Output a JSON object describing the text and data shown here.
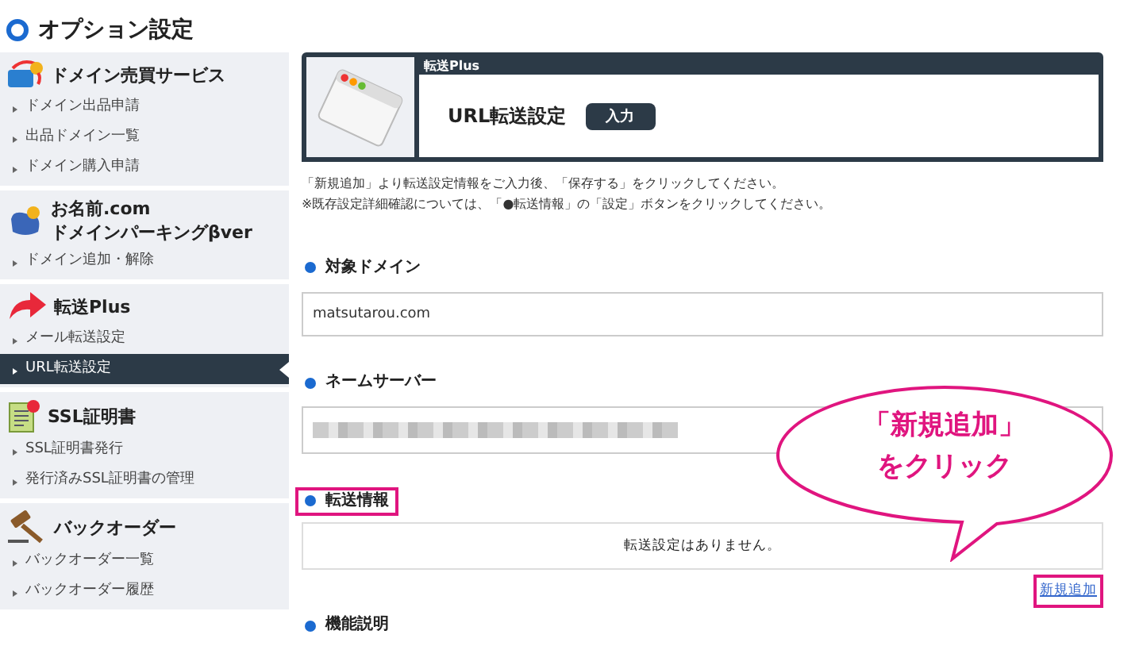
{
  "page_title": "オプション設定",
  "sidebar": [
    {
      "title_lines": [
        "ドメイン売買サービス"
      ],
      "items": [
        {
          "label": "ドメイン出品申請",
          "selected": false
        },
        {
          "label": "出品ドメイン一覧",
          "selected": false
        },
        {
          "label": "ドメイン購入申請",
          "selected": false
        }
      ]
    },
    {
      "title_lines": [
        "お名前.com",
        "ドメインパーキングβver"
      ],
      "items": [
        {
          "label": "ドメイン追加・解除",
          "selected": false
        }
      ]
    },
    {
      "title_lines": [
        "転送Plus"
      ],
      "items": [
        {
          "label": "メール転送設定",
          "selected": false
        },
        {
          "label": "URL転送設定",
          "selected": true
        }
      ]
    },
    {
      "title_lines": [
        "SSL証明書"
      ],
      "items": [
        {
          "label": "SSL証明書発行",
          "selected": false
        },
        {
          "label": "発行済みSSL証明書の管理",
          "selected": false
        }
      ]
    },
    {
      "title_lines": [
        "バックオーダー"
      ],
      "items": [
        {
          "label": "バックオーダー一覧",
          "selected": false
        },
        {
          "label": "バックオーダー履歴",
          "selected": false
        }
      ]
    }
  ],
  "header_card": {
    "category": "転送Plus",
    "title": "URL転送設定",
    "step": "入力"
  },
  "instructions": [
    "「新規追加」より転送設定情報をご入力後、「保存する」をクリックしてください。",
    "※既存設定詳細確認については、「●転送情報」の「設定」ボタンをクリックしてください。"
  ],
  "sections": [
    {
      "kind": "field",
      "heading": "対象ドメイン",
      "value": "matsutarou.com",
      "highlighted": false
    },
    {
      "kind": "blurred",
      "heading": "ネームサーバー",
      "highlighted": false
    },
    {
      "kind": "message",
      "heading": "転送情報",
      "message": "転送設定はありません。",
      "link": "新規追加",
      "highlighted": true,
      "link_highlighted": true
    },
    {
      "kind": "heading",
      "heading": "機能説明",
      "highlighted": false
    }
  ],
  "callout": {
    "lines": [
      "「新規追加」",
      "をクリック"
    ]
  }
}
